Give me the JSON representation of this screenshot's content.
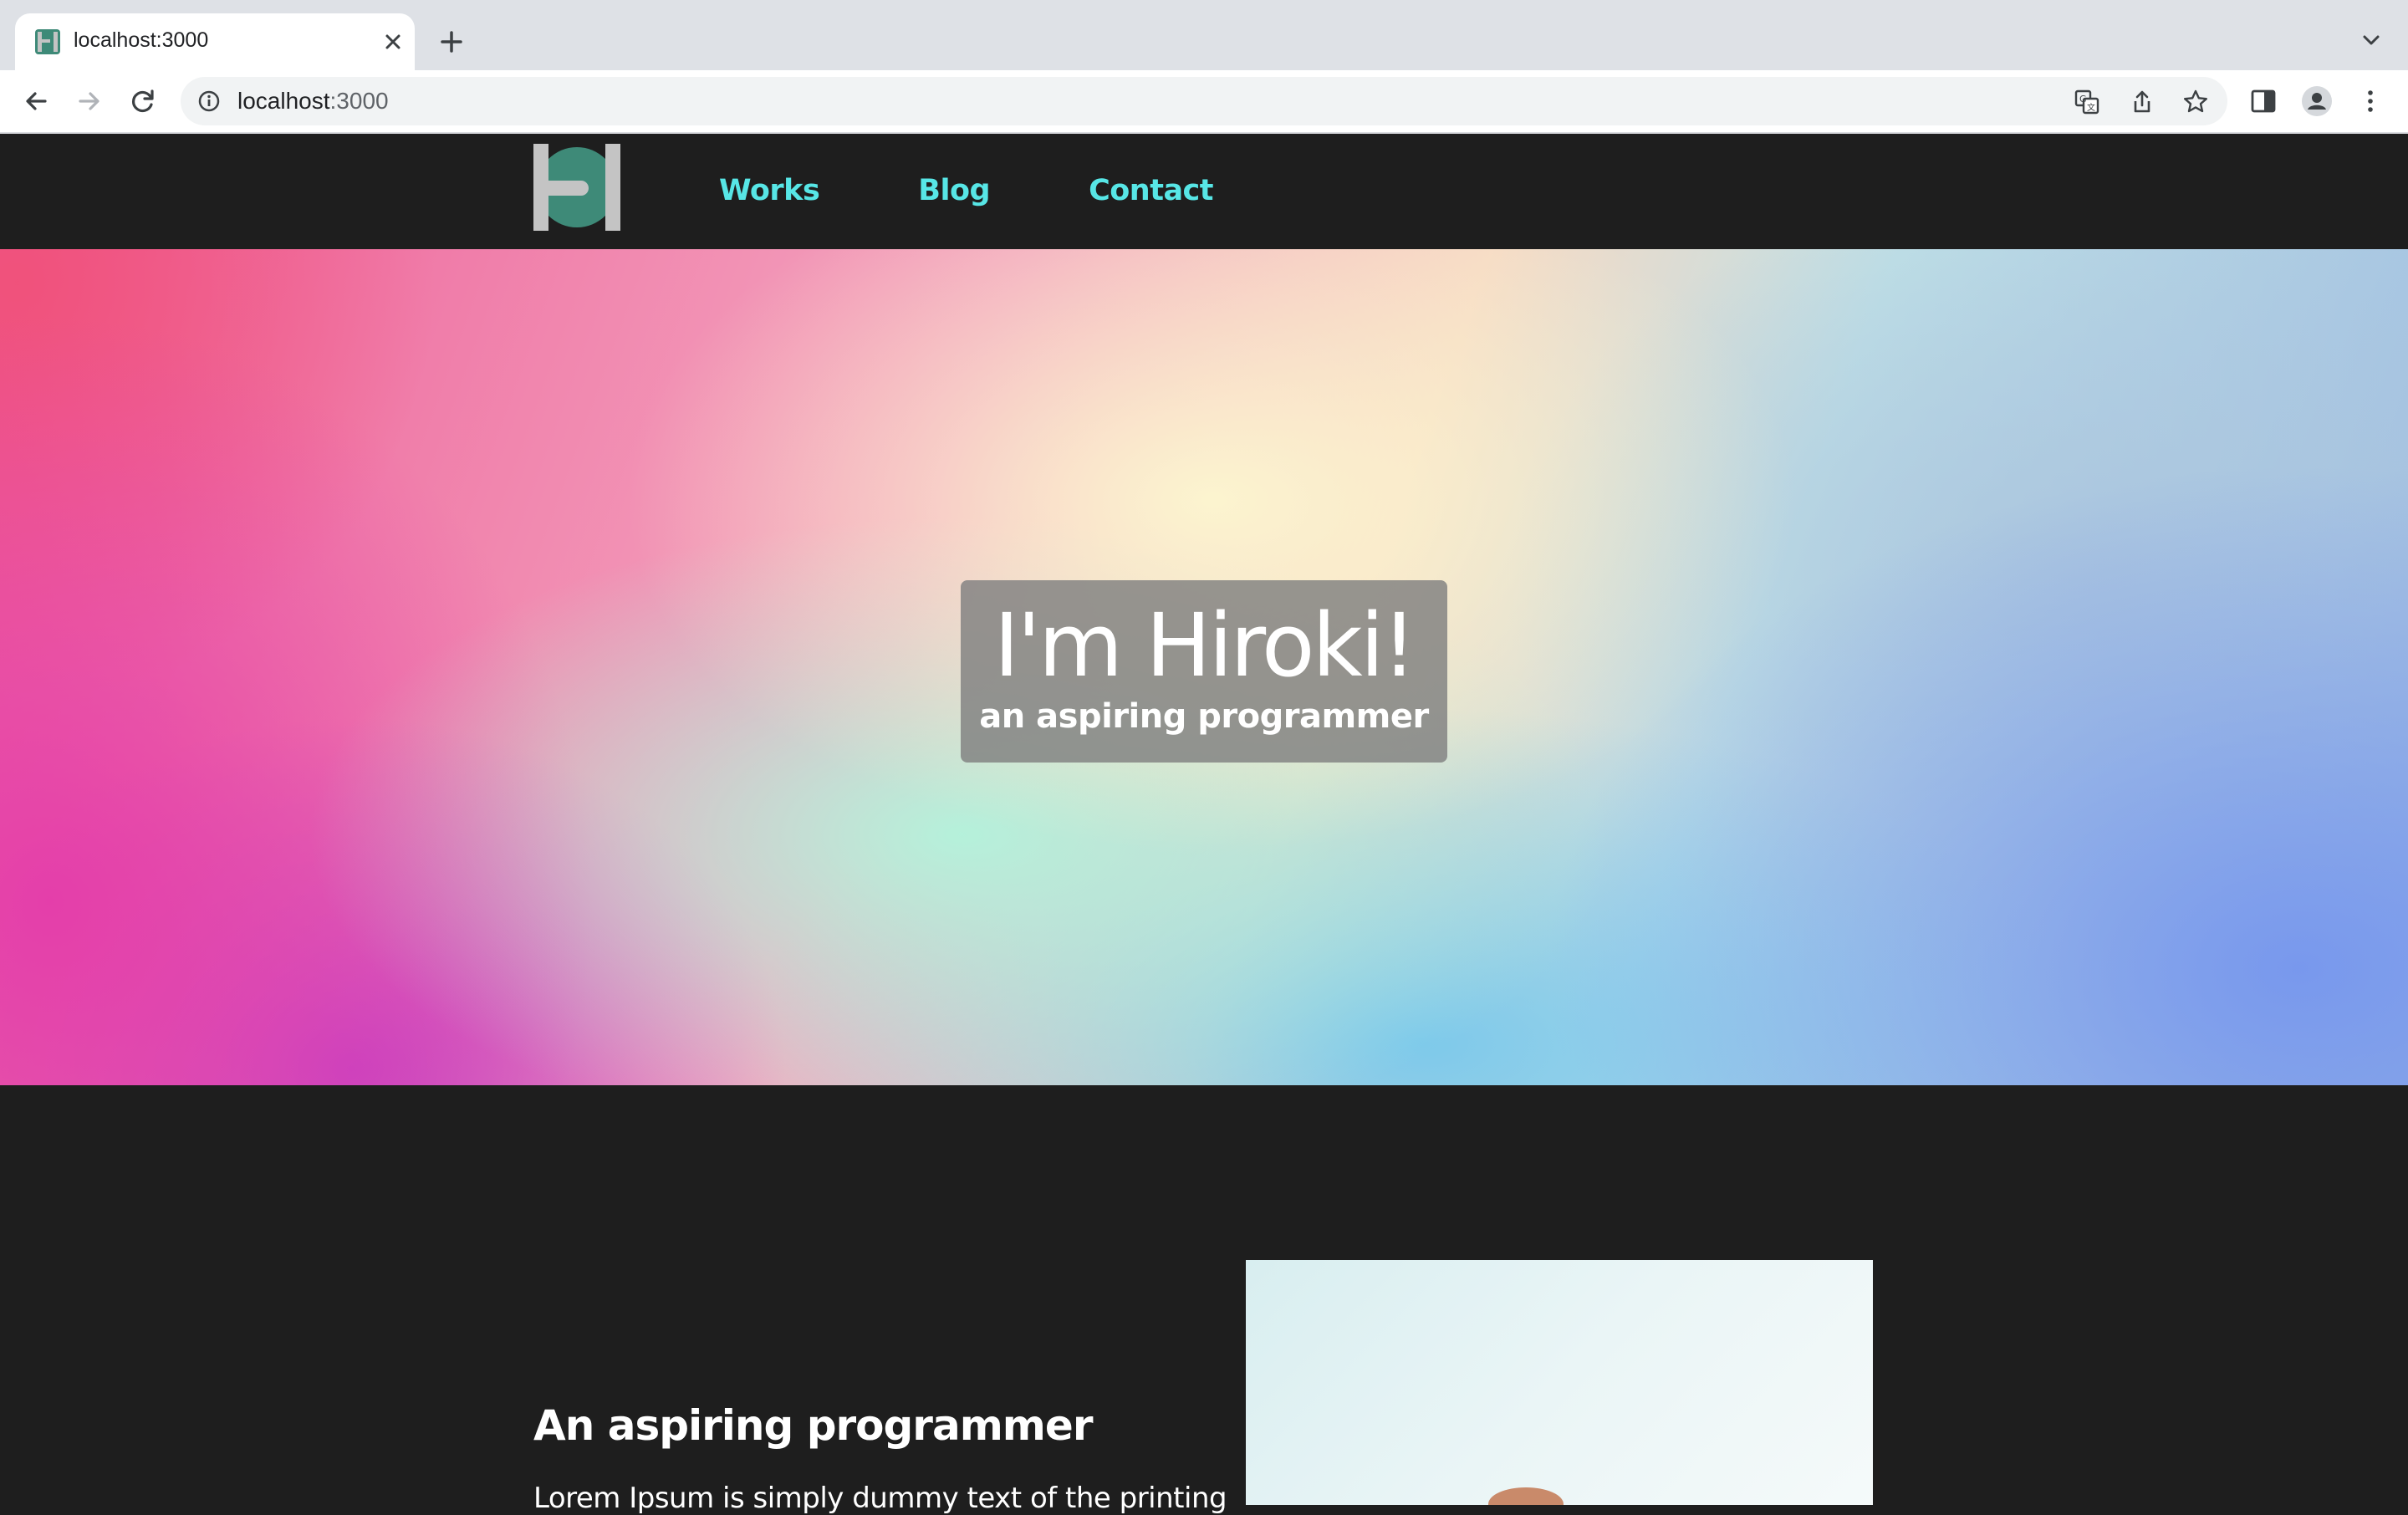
{
  "browser": {
    "tab": {
      "title": "localhost:3000"
    },
    "url": {
      "host": "localhost",
      "port": ":3000"
    }
  },
  "site": {
    "nav": [
      {
        "label": "Works"
      },
      {
        "label": "Blog"
      },
      {
        "label": "Contact"
      }
    ],
    "hero": {
      "title": "I'm Hiroki!",
      "subtitle": "an aspiring programmer"
    },
    "about": {
      "heading": "An aspiring programmer",
      "text": "Lorem Ipsum is simply dummy text of the printing"
    }
  },
  "colors": {
    "nav_link": "#57e6e6",
    "header_bg": "#1e1e1e",
    "logo_teal": "#3e8a78",
    "logo_gray": "#c4c4c4"
  }
}
